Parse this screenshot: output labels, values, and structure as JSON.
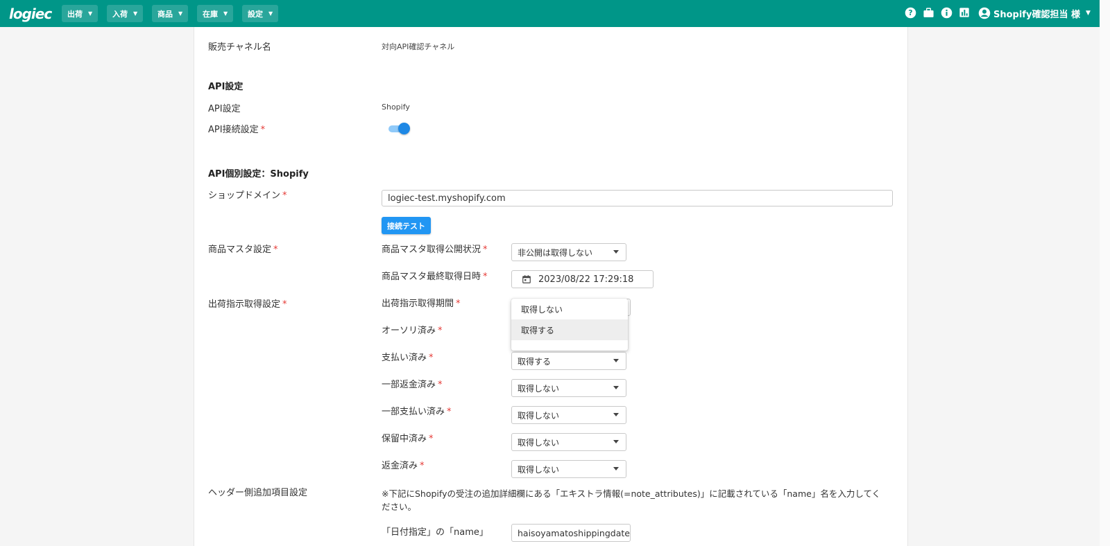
{
  "header": {
    "logo": "logiec",
    "nav": [
      {
        "label": "出荷"
      },
      {
        "label": "入荷"
      },
      {
        "label": "商品"
      },
      {
        "label": "在庫"
      },
      {
        "label": "設定"
      }
    ],
    "user_label": "Shopify確認担当 様"
  },
  "channel": {
    "label": "販売チャネル名",
    "value": "対向API確認チャネル"
  },
  "api": {
    "section_title": "API設定",
    "api_label": "API設定",
    "api_value": "Shopify",
    "connect_label": "API接続設定",
    "connect_enabled": true
  },
  "shopify": {
    "section_title": "API個別設定：Shopify",
    "domain_label": "ショップドメイン",
    "domain_value": "logiec-test.myshopify.com",
    "test_button": "接続テスト"
  },
  "product_master": {
    "label": "商品マスタ設定",
    "status_label": "商品マスタ取得公開状況",
    "status_value": "非公開は取得しない",
    "last_fetch_label": "商品マスタ最終取得日時",
    "last_fetch_value": "2023/08/22 17:29:18"
  },
  "shipping": {
    "label": "出荷指示取得設定",
    "period_label": "出荷指示取得期間",
    "authorized_label": "オーソリ済み",
    "paid_label": "支払い済み",
    "paid_value": "取得する",
    "partially_refunded_label": "一部返金済み",
    "partially_refunded_value": "取得しない",
    "partially_paid_label": "一部支払い済み",
    "partially_paid_value": "取得しない",
    "pending_label": "保留中済み",
    "pending_value": "取得しない",
    "refunded_label": "返金済み",
    "refunded_value": "取得しない",
    "dropdown_options": [
      "取得しない",
      "取得する"
    ],
    "dropdown_highlighted": "取得する"
  },
  "header_extra": {
    "label": "ヘッダー側追加項目設定",
    "note": "※下記にShopifyの受注の追加詳細欄にある「エキストラ情報(=note_attributes)」に記載されている「name」名を入力してください。",
    "date_label": "「日付指定」の「name」",
    "date_value": "haisoyamatoshippingdate"
  },
  "colors": {
    "header_bg": "#009688",
    "primary": "#2196f3",
    "required": "#e53935"
  }
}
